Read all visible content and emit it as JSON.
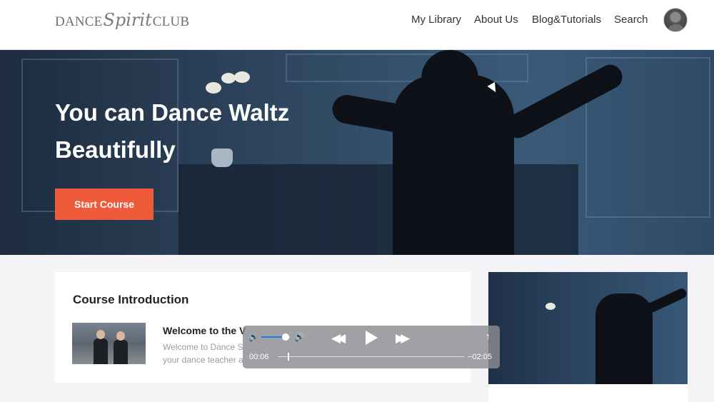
{
  "header": {
    "logo": {
      "part1": "DANCE",
      "part2": "Spirit",
      "part3": "CLUB"
    },
    "nav": [
      "My Library",
      "About Us",
      "Blog&Tutorials",
      "Search"
    ]
  },
  "hero": {
    "title_line1": "You can Dance Waltz",
    "title_line2": "Beautifully",
    "button_label": "Start Course"
  },
  "course": {
    "section_title": "Course Introduction",
    "lesson_title": "Welcome to the V",
    "lesson_desc_line1": "Welcome to Dance S",
    "lesson_desc_line2": "your dance teacher a"
  },
  "player": {
    "current_time": "00:06",
    "remaining_time": "−02:05",
    "volume_low_icon": "🔈",
    "volume_high_icon": "🔊",
    "rewind_icon": "◀◀",
    "forward_icon": "▶▶",
    "share_icon": "↑",
    "volume_level": 0.85,
    "progress": 0.05
  },
  "colors": {
    "accent": "#ee5a3a",
    "volume_fill": "#1a7fe0"
  }
}
